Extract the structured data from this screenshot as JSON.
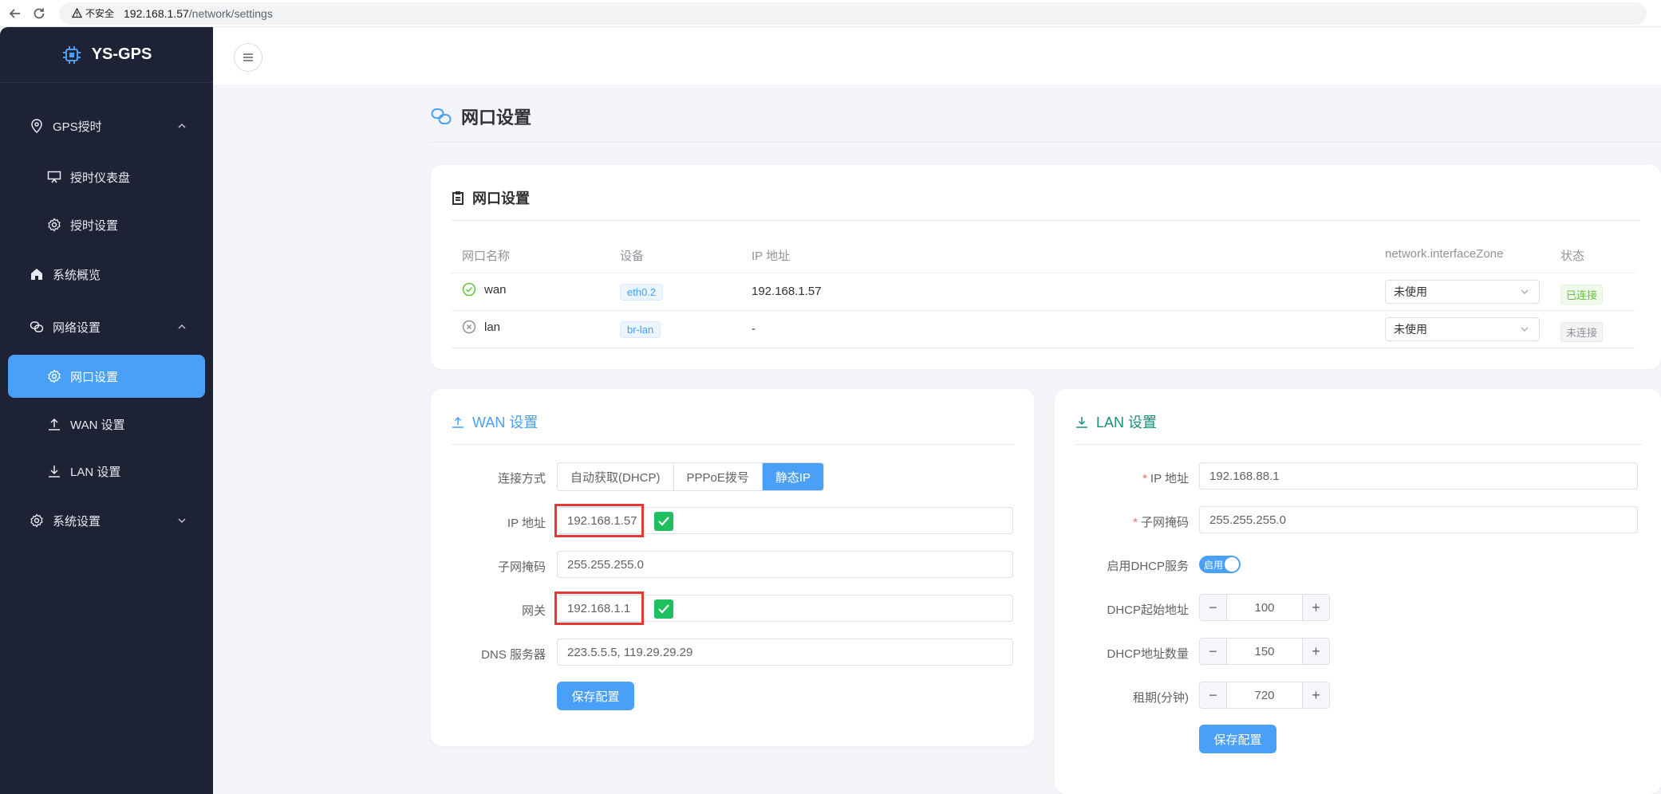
{
  "browser": {
    "security": "不安全",
    "host": "192.168.1.57",
    "path": "/network/settings"
  },
  "brand": {
    "name": "YS-GPS"
  },
  "sidebar": {
    "items": [
      {
        "label": "GPS授时",
        "icon": "location-icon"
      },
      {
        "label": "授时仪表盘",
        "icon": "dashboard-icon"
      },
      {
        "label": "授时设置",
        "icon": "gear-icon"
      },
      {
        "label": "系统概览",
        "icon": "home-icon"
      },
      {
        "label": "网络设置",
        "icon": "link-icon"
      },
      {
        "label": "网口设置",
        "icon": "gear-icon"
      },
      {
        "label": "WAN 设置",
        "icon": "upload-icon"
      },
      {
        "label": "LAN 设置",
        "icon": "download-icon"
      },
      {
        "label": "系统设置",
        "icon": "gear-icon"
      }
    ]
  },
  "page": {
    "title": "网口设置"
  },
  "ports": {
    "title": "网口设置",
    "headers": [
      "网口名称",
      "设备",
      "IP 地址",
      "network.interfaceZone",
      "状态"
    ],
    "rows": [
      {
        "name": "wan",
        "device": "eth0.2",
        "ip": "192.168.1.57",
        "zone": "未使用",
        "status": "已连接",
        "connected": true
      },
      {
        "name": "lan",
        "device": "br-lan",
        "ip": "-",
        "zone": "未使用",
        "status": "未连接",
        "connected": false
      }
    ]
  },
  "wan": {
    "title": "WAN 设置",
    "mode_label": "连接方式",
    "modes": [
      "自动获取(DHCP)",
      "PPPoE拨号",
      "静态IP"
    ],
    "selected_mode": "静态IP",
    "ip_label": "IP 地址",
    "ip": "192.168.1.57",
    "mask_label": "子网掩码",
    "mask": "255.255.255.0",
    "gateway_label": "网关",
    "gateway": "192.168.1.1",
    "dns_label": "DNS 服务器",
    "dns": "223.5.5.5, 119.29.29.29",
    "save": "保存配置"
  },
  "lan": {
    "title": "LAN 设置",
    "ip_label": "IP 地址",
    "ip": "192.168.88.1",
    "mask_label": "子网掩码",
    "mask": "255.255.255.0",
    "dhcp_label": "启用DHCP服务",
    "dhcp_toggle": "启用",
    "dhcp_enabled": true,
    "start_label": "DHCP起始地址",
    "start": "100",
    "count_label": "DHCP地址数量",
    "count": "150",
    "lease_label": "租期(分钟)",
    "lease": "720",
    "minus": "−",
    "plus": "+",
    "save": "保存配置"
  },
  "colors": {
    "sidebar_bg": "#1d2235",
    "accent": "#4a9ff7",
    "success": "#67c23a",
    "highlight_border": "#e53935"
  }
}
